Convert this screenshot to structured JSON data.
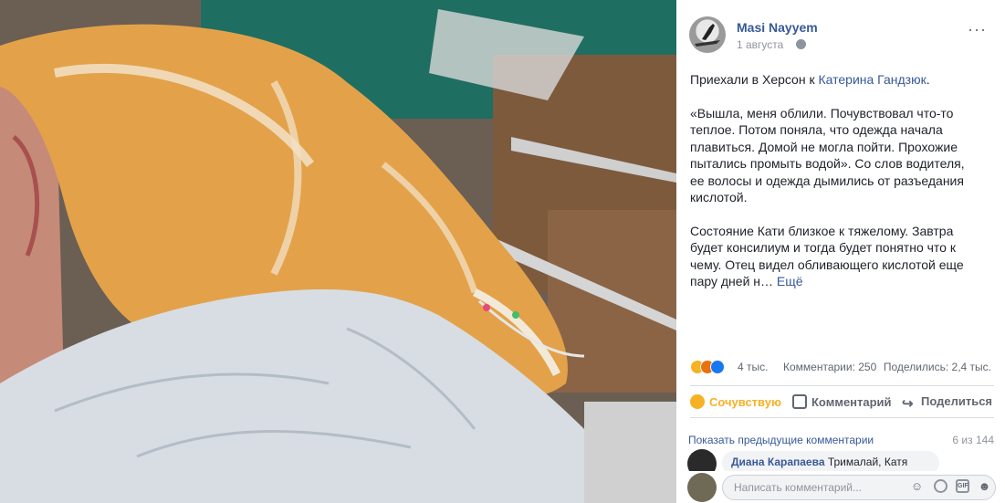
{
  "post": {
    "author": "Masi Nayyem",
    "date": "1 августа",
    "more": "···",
    "intro_text": "Приехали в Херсон к ",
    "mention": "Катерина Гандзюк",
    "intro_end": ".",
    "quote": "«Вышла, меня облили. Почувствовал что-то теплое. Потом поняла, что одежда начала плавиться. Домой не могла пойти. Прохожие пытались промыть водой». Со слов водителя, ее волосы и одежда дымились от разъедания кислотой.",
    "status_text": "Состояние Кати близкое к тяжелому. Завтра будет консилиум и тогда будет понятно что к чему. Отец видел обливающего кислотой еще пару дней н… ",
    "see_more": "Ещё"
  },
  "stats": {
    "reactions": "4 тыс.",
    "comments": "Комментарии: 250",
    "shares": "Поделились: 2,4 тыс."
  },
  "actions": {
    "react": "Сочувствую",
    "comment": "Комментарий",
    "share": "Поделиться"
  },
  "comments": {
    "show_previous": "Показать предыдущие комментарии",
    "count": "6 из 144",
    "first_author": "Диана Карапаева",
    "first_text": " Трималай, Катя"
  },
  "composer": {
    "placeholder": "Написать комментарий...",
    "gif": "GIF"
  },
  "colors": {
    "link": "#385898",
    "sympathy": "#f7b125",
    "muted": "#90949c"
  }
}
